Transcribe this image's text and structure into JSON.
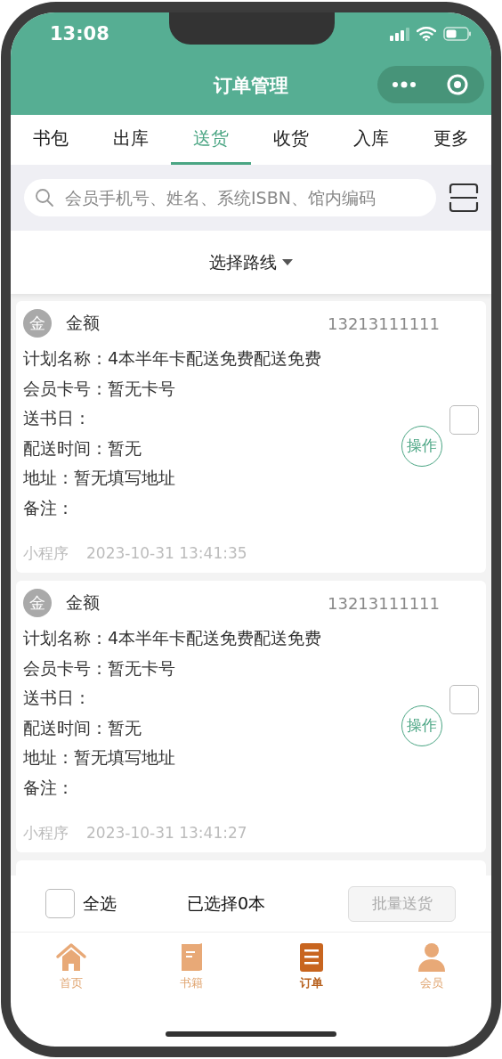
{
  "status_bar": {
    "time": "13:08"
  },
  "nav": {
    "title": "订单管理"
  },
  "tabs": [
    {
      "label": "书包",
      "selected": false
    },
    {
      "label": "出库",
      "selected": false
    },
    {
      "label": "送货",
      "selected": true
    },
    {
      "label": "收货",
      "selected": false
    },
    {
      "label": "入库",
      "selected": false
    },
    {
      "label": "更多",
      "selected": false
    }
  ],
  "search": {
    "placeholder": "会员手机号、姓名、系统ISBN、馆内编码"
  },
  "route_filter": {
    "label": "选择路线"
  },
  "orders": [
    {
      "avatar": "金",
      "name": "金额",
      "phone": "13213111111",
      "lines": [
        "计划名称：4本半年卡配送免费配送免费",
        "会员卡号：暂无卡号",
        "送书日：",
        "配送时间：暂无",
        "地址：暂无填写地址",
        "备注："
      ],
      "source": "小程序",
      "time": "2023-10-31 13:41:35",
      "action": "操作",
      "checked": false
    },
    {
      "avatar": "金",
      "name": "金额",
      "phone": "13213111111",
      "lines": [
        "计划名称：4本半年卡配送免费配送免费",
        "会员卡号：暂无卡号",
        "送书日：",
        "配送时间：暂无",
        "地址：暂无填写地址",
        "备注："
      ],
      "source": "小程序",
      "time": "2023-10-31 13:41:27",
      "action": "操作",
      "checked": false
    }
  ],
  "bulk_bar": {
    "select_all": {
      "label": "全选",
      "checked": false
    },
    "count": "已选择0本",
    "button": {
      "label": "批量送货",
      "disabled": true
    }
  },
  "tab_bar": [
    {
      "label": "首页",
      "kind": "home",
      "selected": false
    },
    {
      "label": "书籍",
      "kind": "book",
      "selected": false
    },
    {
      "label": "订单",
      "kind": "list",
      "selected": true
    },
    {
      "label": "会员",
      "kind": "person",
      "selected": false
    }
  ]
}
